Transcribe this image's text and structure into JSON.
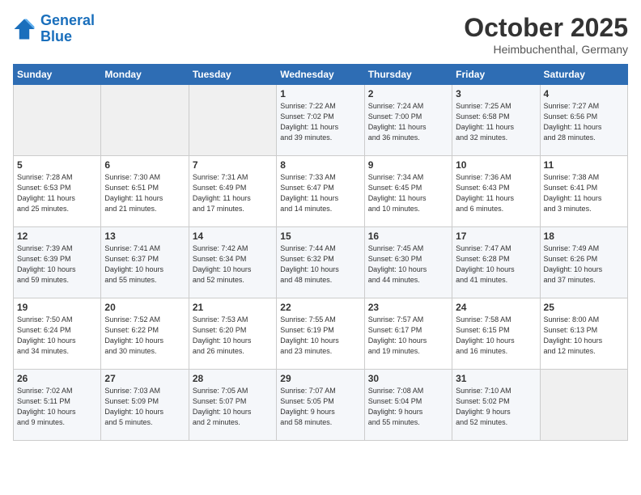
{
  "logo": {
    "line1": "General",
    "line2": "Blue"
  },
  "title": "October 2025",
  "subtitle": "Heimbuchenthal, Germany",
  "days_of_week": [
    "Sunday",
    "Monday",
    "Tuesday",
    "Wednesday",
    "Thursday",
    "Friday",
    "Saturday"
  ],
  "weeks": [
    [
      {
        "day": "",
        "info": ""
      },
      {
        "day": "",
        "info": ""
      },
      {
        "day": "",
        "info": ""
      },
      {
        "day": "1",
        "info": "Sunrise: 7:22 AM\nSunset: 7:02 PM\nDaylight: 11 hours\nand 39 minutes."
      },
      {
        "day": "2",
        "info": "Sunrise: 7:24 AM\nSunset: 7:00 PM\nDaylight: 11 hours\nand 36 minutes."
      },
      {
        "day": "3",
        "info": "Sunrise: 7:25 AM\nSunset: 6:58 PM\nDaylight: 11 hours\nand 32 minutes."
      },
      {
        "day": "4",
        "info": "Sunrise: 7:27 AM\nSunset: 6:56 PM\nDaylight: 11 hours\nand 28 minutes."
      }
    ],
    [
      {
        "day": "5",
        "info": "Sunrise: 7:28 AM\nSunset: 6:53 PM\nDaylight: 11 hours\nand 25 minutes."
      },
      {
        "day": "6",
        "info": "Sunrise: 7:30 AM\nSunset: 6:51 PM\nDaylight: 11 hours\nand 21 minutes."
      },
      {
        "day": "7",
        "info": "Sunrise: 7:31 AM\nSunset: 6:49 PM\nDaylight: 11 hours\nand 17 minutes."
      },
      {
        "day": "8",
        "info": "Sunrise: 7:33 AM\nSunset: 6:47 PM\nDaylight: 11 hours\nand 14 minutes."
      },
      {
        "day": "9",
        "info": "Sunrise: 7:34 AM\nSunset: 6:45 PM\nDaylight: 11 hours\nand 10 minutes."
      },
      {
        "day": "10",
        "info": "Sunrise: 7:36 AM\nSunset: 6:43 PM\nDaylight: 11 hours\nand 6 minutes."
      },
      {
        "day": "11",
        "info": "Sunrise: 7:38 AM\nSunset: 6:41 PM\nDaylight: 11 hours\nand 3 minutes."
      }
    ],
    [
      {
        "day": "12",
        "info": "Sunrise: 7:39 AM\nSunset: 6:39 PM\nDaylight: 10 hours\nand 59 minutes."
      },
      {
        "day": "13",
        "info": "Sunrise: 7:41 AM\nSunset: 6:37 PM\nDaylight: 10 hours\nand 55 minutes."
      },
      {
        "day": "14",
        "info": "Sunrise: 7:42 AM\nSunset: 6:34 PM\nDaylight: 10 hours\nand 52 minutes."
      },
      {
        "day": "15",
        "info": "Sunrise: 7:44 AM\nSunset: 6:32 PM\nDaylight: 10 hours\nand 48 minutes."
      },
      {
        "day": "16",
        "info": "Sunrise: 7:45 AM\nSunset: 6:30 PM\nDaylight: 10 hours\nand 44 minutes."
      },
      {
        "day": "17",
        "info": "Sunrise: 7:47 AM\nSunset: 6:28 PM\nDaylight: 10 hours\nand 41 minutes."
      },
      {
        "day": "18",
        "info": "Sunrise: 7:49 AM\nSunset: 6:26 PM\nDaylight: 10 hours\nand 37 minutes."
      }
    ],
    [
      {
        "day": "19",
        "info": "Sunrise: 7:50 AM\nSunset: 6:24 PM\nDaylight: 10 hours\nand 34 minutes."
      },
      {
        "day": "20",
        "info": "Sunrise: 7:52 AM\nSunset: 6:22 PM\nDaylight: 10 hours\nand 30 minutes."
      },
      {
        "day": "21",
        "info": "Sunrise: 7:53 AM\nSunset: 6:20 PM\nDaylight: 10 hours\nand 26 minutes."
      },
      {
        "day": "22",
        "info": "Sunrise: 7:55 AM\nSunset: 6:19 PM\nDaylight: 10 hours\nand 23 minutes."
      },
      {
        "day": "23",
        "info": "Sunrise: 7:57 AM\nSunset: 6:17 PM\nDaylight: 10 hours\nand 19 minutes."
      },
      {
        "day": "24",
        "info": "Sunrise: 7:58 AM\nSunset: 6:15 PM\nDaylight: 10 hours\nand 16 minutes."
      },
      {
        "day": "25",
        "info": "Sunrise: 8:00 AM\nSunset: 6:13 PM\nDaylight: 10 hours\nand 12 minutes."
      }
    ],
    [
      {
        "day": "26",
        "info": "Sunrise: 7:02 AM\nSunset: 5:11 PM\nDaylight: 10 hours\nand 9 minutes."
      },
      {
        "day": "27",
        "info": "Sunrise: 7:03 AM\nSunset: 5:09 PM\nDaylight: 10 hours\nand 5 minutes."
      },
      {
        "day": "28",
        "info": "Sunrise: 7:05 AM\nSunset: 5:07 PM\nDaylight: 10 hours\nand 2 minutes."
      },
      {
        "day": "29",
        "info": "Sunrise: 7:07 AM\nSunset: 5:05 PM\nDaylight: 9 hours\nand 58 minutes."
      },
      {
        "day": "30",
        "info": "Sunrise: 7:08 AM\nSunset: 5:04 PM\nDaylight: 9 hours\nand 55 minutes."
      },
      {
        "day": "31",
        "info": "Sunrise: 7:10 AM\nSunset: 5:02 PM\nDaylight: 9 hours\nand 52 minutes."
      },
      {
        "day": "",
        "info": ""
      }
    ]
  ]
}
